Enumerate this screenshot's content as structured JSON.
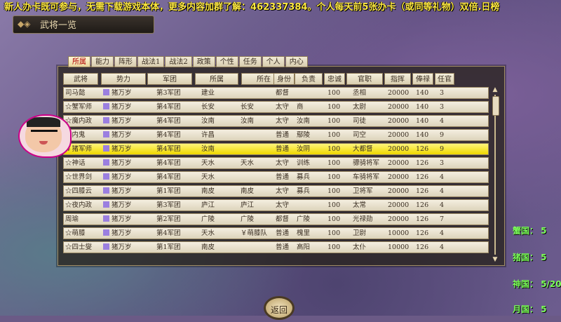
{
  "banner": "新人办卡既可参与，无需下载游戏本体，更多内容加群了解：462337384。个人每天前5张办卡（或同等礼物）双倍.日榜",
  "window": {
    "title": "武将一览"
  },
  "tabs": [
    "所属",
    "能力",
    "阵形",
    "战法1",
    "战法2",
    "政策",
    "个性",
    "任务",
    "个人",
    "内心"
  ],
  "columns": [
    "武将",
    "势力",
    "军团",
    "所属",
    "所在",
    "身份",
    "负责",
    "忠诚",
    "官职",
    "指挥",
    "俸禄",
    "任官"
  ],
  "rows": [
    {
      "name": "司马懿",
      "force": "猪万岁",
      "corps": "第3军团",
      "belong": "建业",
      "loc": "",
      "rank": "都督",
      "duty": "",
      "loyal": "100",
      "office": "丞相",
      "cmd": "20000",
      "pay": "140",
      "term": "3"
    },
    {
      "name": "☆蟹军师",
      "force": "猪万岁",
      "corps": "第4军团",
      "belong": "长安",
      "loc": "长安",
      "rank": "太守",
      "duty": "商",
      "loyal": "100",
      "office": "太尉",
      "cmd": "20000",
      "pay": "140",
      "term": "3"
    },
    {
      "name": "☆魔内政",
      "force": "猪万岁",
      "corps": "第4军团",
      "belong": "汝南",
      "loc": "汝南",
      "rank": "太守",
      "duty": "汝南",
      "loyal": "100",
      "office": "司徒",
      "cmd": "20000",
      "pay": "140",
      "term": "4"
    },
    {
      "name": "￥内鬼",
      "force": "猪万岁",
      "corps": "第4军团",
      "belong": "许昌",
      "loc": "",
      "rank": "普通",
      "duty": "鄢陵",
      "loyal": "100",
      "office": "司空",
      "cmd": "20000",
      "pay": "140",
      "term": "9"
    },
    {
      "name": "￥猪军师",
      "force": "猪万岁",
      "corps": "第4军团",
      "belong": "汝南",
      "loc": "",
      "rank": "普通",
      "duty": "汝阴",
      "loyal": "100",
      "office": "大都督",
      "cmd": "20000",
      "pay": "126",
      "term": "9"
    },
    {
      "name": "☆神话",
      "force": "猪万岁",
      "corps": "第4军团",
      "belong": "天水",
      "loc": "天水",
      "rank": "太守",
      "duty": "训练",
      "loyal": "100",
      "office": "骠骑将军",
      "cmd": "20000",
      "pay": "126",
      "term": "3"
    },
    {
      "name": "☆世界剑",
      "force": "猪万岁",
      "corps": "第4军团",
      "belong": "天水",
      "loc": "",
      "rank": "普通",
      "duty": "募兵",
      "loyal": "100",
      "office": "车骑将军",
      "cmd": "20000",
      "pay": "126",
      "term": "4"
    },
    {
      "name": "☆四膝云",
      "force": "猪万岁",
      "corps": "第1军团",
      "belong": "南皮",
      "loc": "南皮",
      "rank": "太守",
      "duty": "募兵",
      "loyal": "100",
      "office": "卫将军",
      "cmd": "20000",
      "pay": "126",
      "term": "4"
    },
    {
      "name": "☆夜内政",
      "force": "猪万岁",
      "corps": "第3军团",
      "belong": "庐江",
      "loc": "庐江",
      "rank": "太守",
      "duty": "",
      "loyal": "100",
      "office": "太常",
      "cmd": "20000",
      "pay": "126",
      "term": "4"
    },
    {
      "name": "周瑜",
      "force": "猪万岁",
      "corps": "第2军团",
      "belong": "广陵",
      "loc": "广陵",
      "rank": "都督",
      "duty": "广陵",
      "loyal": "100",
      "office": "光禄勋",
      "cmd": "20000",
      "pay": "126",
      "term": "7"
    },
    {
      "name": "☆萌膝",
      "force": "猪万岁",
      "corps": "第4军团",
      "belong": "天水",
      "loc": "￥萌膝队",
      "rank": "普通",
      "duty": "槐里",
      "loyal": "100",
      "office": "卫尉",
      "cmd": "10000",
      "pay": "126",
      "term": "4"
    },
    {
      "name": "☆四士燮",
      "force": "猪万岁",
      "corps": "第1军团",
      "belong": "南皮",
      "loc": "",
      "rank": "普通",
      "duty": "高阳",
      "loyal": "100",
      "office": "太仆",
      "cmd": "10000",
      "pay": "126",
      "term": "4"
    }
  ],
  "selected_index": 4,
  "back_label": "返回",
  "side_stats": [
    {
      "label": "蟹国：",
      "value": "5"
    },
    {
      "label": "猪国：",
      "value": "5"
    },
    {
      "label": "神国：",
      "value": "5/20"
    },
    {
      "label": "月国：",
      "value": "5"
    }
  ],
  "colors": {
    "banner": "#ffe940",
    "selected_row": "#f5e000",
    "force_swatch": "#9b7fe0",
    "side_text": "#7cff5a"
  }
}
